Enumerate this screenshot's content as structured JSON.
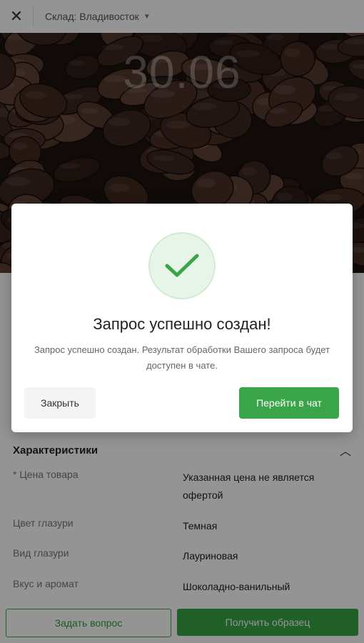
{
  "topbar": {
    "close_icon": "close-icon",
    "warehouse": "Склад: Владивосток",
    "chevron": "chevron-down-icon"
  },
  "hero": {
    "date": "30.06"
  },
  "characteristics": {
    "title": "Характеристики",
    "rows": [
      {
        "key": "* Цена товара",
        "value": "Указанная цена не является офертой"
      },
      {
        "key": "Цвет глазури",
        "value": "Темная"
      },
      {
        "key": "Вид глазури",
        "value": "Лауриновая"
      },
      {
        "key": "Вкус и аромат",
        "value": "Шоколадно-ванильный"
      }
    ]
  },
  "bottom": {
    "ask_label": "Задать вопрос",
    "sample_label": "Получить образец"
  },
  "modal": {
    "title": "Запрос успешно создан!",
    "description": "Запрос успешно создан. Результат обработки Вашего запроса будет доступен в чате.",
    "close_label": "Закрыть",
    "chat_label": "Перейти в чат"
  },
  "colors": {
    "accent": "#3aa548",
    "overlay": "rgba(0,0,0,0.42)"
  }
}
